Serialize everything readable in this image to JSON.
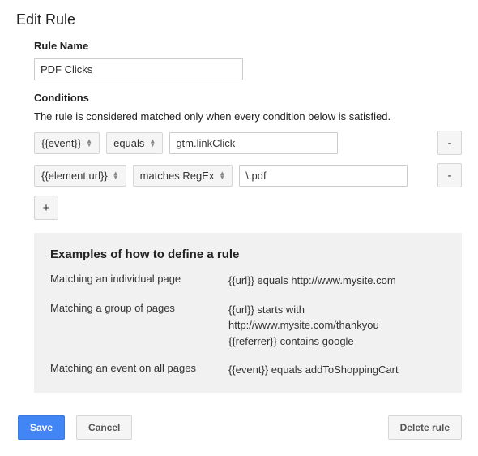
{
  "title": "Edit Rule",
  "ruleName": {
    "label": "Rule Name",
    "value": "PDF Clicks"
  },
  "conditions": {
    "label": "Conditions",
    "helper": "The rule is considered matched only when every condition below is satisfied.",
    "rows": [
      {
        "variable": "{{event}}",
        "operator": "equals",
        "value": "gtm.linkClick",
        "remove": "-"
      },
      {
        "variable": "{{element url}}",
        "operator": "matches RegEx",
        "value": "\\.pdf",
        "remove": "-"
      }
    ],
    "add": "+"
  },
  "examples": {
    "title": "Examples of how to define a rule",
    "rows": [
      {
        "label": "Matching an individual page",
        "body": "{{url}} equals http://www.mysite.com"
      },
      {
        "label": "Matching a group of pages",
        "body": "{{url}} starts with http://www.mysite.com/thankyou\n{{referrer}} contains google"
      },
      {
        "label": "Matching an event on all pages",
        "body": "{{event}} equals addToShoppingCart"
      }
    ]
  },
  "footer": {
    "save": "Save",
    "cancel": "Cancel",
    "delete": "Delete rule"
  }
}
